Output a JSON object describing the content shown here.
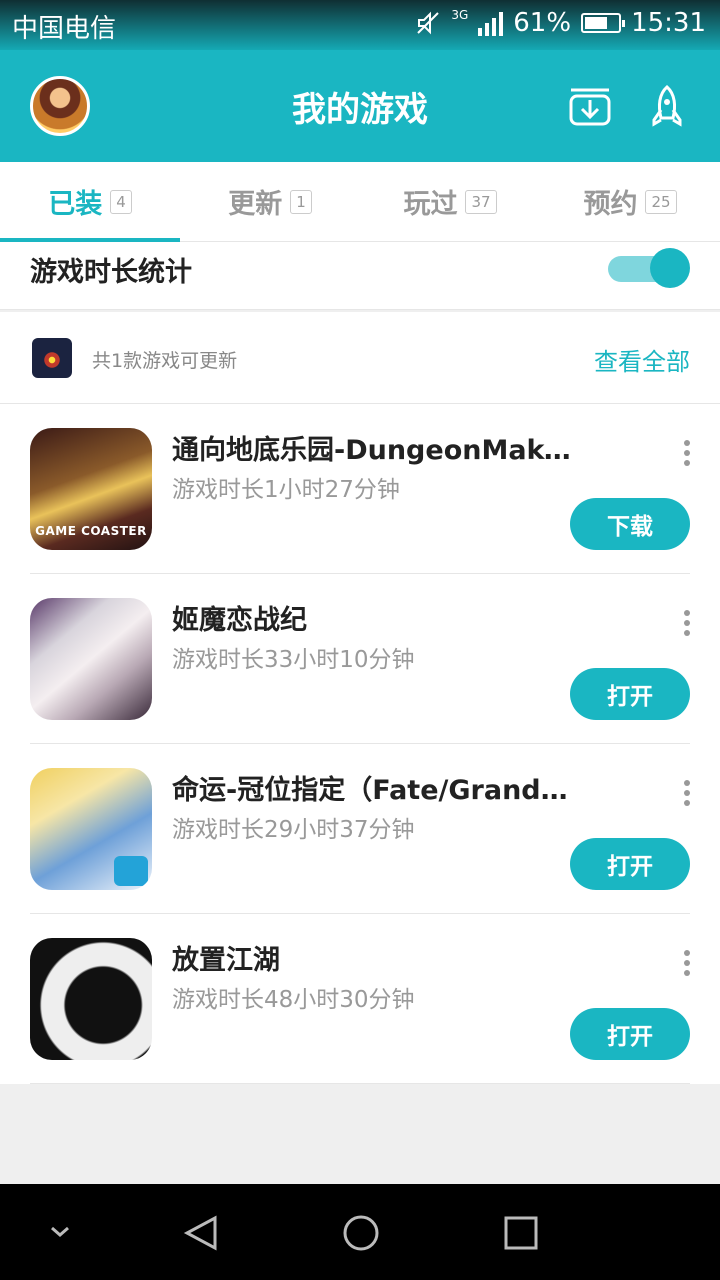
{
  "status_bar": {
    "carrier": "中国电信",
    "network": "3G",
    "battery": "61%",
    "time": "15:31"
  },
  "header": {
    "title": "我的游戏",
    "icons": [
      "avatar",
      "download-icon",
      "rocket-icon"
    ]
  },
  "tabs": [
    {
      "label": "已装",
      "count": "4",
      "active": true
    },
    {
      "label": "更新",
      "count": "1",
      "active": false
    },
    {
      "label": "玩过",
      "count": "37",
      "active": false
    },
    {
      "label": "预约",
      "count": "25",
      "active": false
    }
  ],
  "stats": {
    "label": "游戏时长统计",
    "toggle_on": true
  },
  "updates": {
    "text": "共1款游戏可更新",
    "view_all": "查看全部"
  },
  "games": [
    {
      "name": "通向地底乐园-DungeonMaker",
      "duration": "游戏时长1小时27分钟",
      "button": "下载",
      "icon_text": "GAME COASTER"
    },
    {
      "name": "姬魔恋战纪",
      "duration": "游戏时长33小时10分钟",
      "button": "打开"
    },
    {
      "name": "命运-冠位指定（Fate/Grand Order）",
      "duration": "游戏时长29小时37分钟",
      "button": "打开"
    },
    {
      "name": "放置江湖",
      "duration": "游戏时长48小时30分钟",
      "button": "打开"
    }
  ],
  "colors": {
    "accent": "#1ab6c2",
    "text_secondary": "#999999"
  }
}
